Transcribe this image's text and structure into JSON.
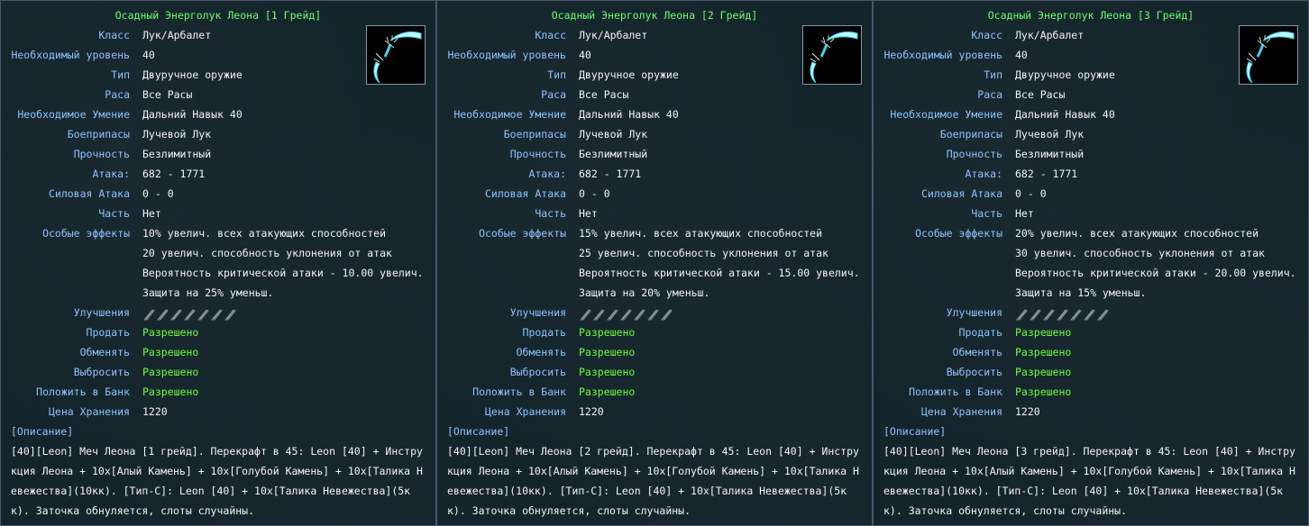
{
  "colors": {
    "label": "#8fc3ff",
    "value": "#f4f4f4",
    "title": "#6dff6d",
    "allowed": "#6dff3c",
    "background": "#14242b"
  },
  "labels": {
    "class": "Класс",
    "level": "Необходимый уровень",
    "type": "Тип",
    "race": "Раса",
    "skill": "Необходимое Умение",
    "ammo": "Боеприпасы",
    "durability": "Прочность",
    "attack": "Атака:",
    "power_attack": "Силовая Атака",
    "part": "Часть",
    "effects": "Особые эффекты",
    "upgrades": "Улучшения",
    "sell": "Продать",
    "trade": "Обменять",
    "drop": "Выбросить",
    "bank": "Положить в Банк",
    "storage_price": "Цена Хранения",
    "description": "[Описание]"
  },
  "panels": [
    {
      "title": "Осадный Энерголук Леона [1 Грейд]",
      "icon": "bow-item-icon",
      "class": "Лук/Арбалет",
      "level": "40",
      "type": "Двуручное оружие",
      "race": "Все Расы",
      "skill": "Дальний Навык 40",
      "ammo": "Лучевой Лук",
      "durability": "Безлимитный",
      "attack": "682 - 1771",
      "power_attack": "0 - 0",
      "part": "Нет",
      "effects": [
        "10% увелич. всех атакующих способностей",
        "20 увелич. способность уклонения от атак",
        "Вероятность критической атаки - 10.00 увелич.",
        "Защита на 25% уменьш."
      ],
      "upgrade_slots": 7,
      "sell": "Разрешено",
      "trade": "Разрешено",
      "drop": "Разрешено",
      "bank": "Разрешено",
      "storage_price": "1220",
      "description": "[40][Leon] Меч Леона [1 грейд]. Перекрафт в 45: Leon [40] + Инструкция Леона + 10x[Алый Камень] + 10x[Голубой Камень] + 10x[Талика Невежества](10кк). [Тип-C]: Leon [40] + 10x[Талика Невежества](5кк). Заточка обнуляется, слоты случайны."
    },
    {
      "title": "Осадный Энерголук Леона [2 Грейд]",
      "icon": "bow-item-icon",
      "class": "Лук/Арбалет",
      "level": "40",
      "type": "Двуручное оружие",
      "race": "Все Расы",
      "skill": "Дальний Навык 40",
      "ammo": "Лучевой Лук",
      "durability": "Безлимитный",
      "attack": "682 - 1771",
      "power_attack": "0 - 0",
      "part": "Нет",
      "effects": [
        "15% увелич. всех атакующих способностей",
        "25 увелич. способность уклонения от атак",
        "Вероятность критической атаки - 15.00 увелич.",
        "Защита на 20% уменьш."
      ],
      "upgrade_slots": 7,
      "sell": "Разрешено",
      "trade": "Разрешено",
      "drop": "Разрешено",
      "bank": "Разрешено",
      "storage_price": "1220",
      "description": "[40][Leon] Меч Леона [2 грейд]. Перекрафт в 45: Leon [40] + Инструкция Леона + 10x[Алый Камень] + 10x[Голубой Камень] + 10x[Талика Невежества](10кк). [Тип-C]: Leon [40] + 10x[Талика Невежества](5кк). Заточка обнуляется, слоты случайны."
    },
    {
      "title": "Осадный Энерголук Леона [3 Грейд]",
      "icon": "bow-item-icon",
      "class": "Лук/Арбалет",
      "level": "40",
      "type": "Двуручное оружие",
      "race": "Все Расы",
      "skill": "Дальний Навык 40",
      "ammo": "Лучевой Лук",
      "durability": "Безлимитный",
      "attack": "682 - 1771",
      "power_attack": "0 - 0",
      "part": "Нет",
      "effects": [
        "20% увелич. всех атакующих способностей",
        "30 увелич. способность уклонения от атак",
        "Вероятность критической атаки - 20.00 увелич.",
        "Защита на 15% уменьш."
      ],
      "upgrade_slots": 7,
      "sell": "Разрешено",
      "trade": "Разрешено",
      "drop": "Разрешено",
      "bank": "Разрешено",
      "storage_price": "1220",
      "description": "[40][Leon] Меч Леона [3 грейд]. Перекрафт в 45: Leon [40] + Инструкция Леона + 10x[Алый Камень] + 10x[Голубой Камень] + 10x[Талика Невежества](10кк). [Тип-C]: Leon [40] + 10x[Талика Невежества](5кк). Заточка обнуляется, слоты случайны."
    }
  ]
}
